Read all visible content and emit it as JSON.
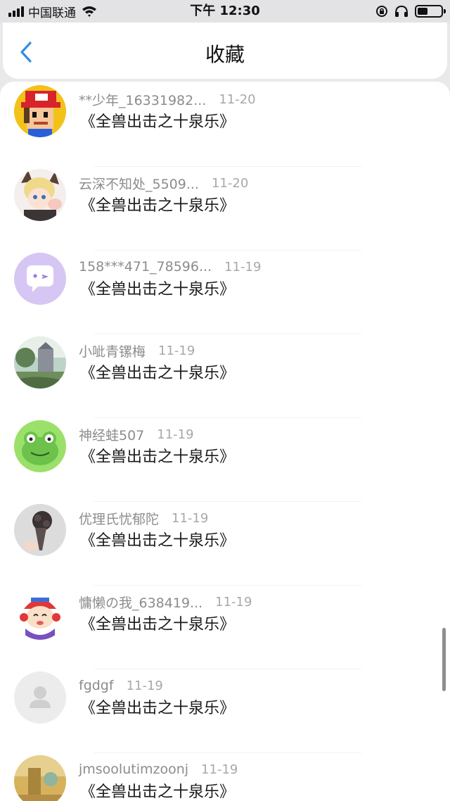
{
  "status_bar": {
    "carrier": "中国联通",
    "time": "下午 12:30",
    "battery_level": 0.45
  },
  "header": {
    "title": "收藏"
  },
  "items": [
    {
      "user": "**少年_16331982...",
      "date": "11-20",
      "content_title": "《全兽出击之十泉乐》",
      "avatar": "pixel-mario-avatar"
    },
    {
      "user": "云深不知处_5509...",
      "date": "11-20",
      "content_title": "《全兽出击之十泉乐》",
      "avatar": "anime-girl-avatar"
    },
    {
      "user": "158***471_78596...",
      "date": "11-19",
      "content_title": "《全兽出击之十泉乐》",
      "avatar": "purple-chat-avatar"
    },
    {
      "user": "小呲青镙梅",
      "date": "11-19",
      "content_title": "《全兽出击之十泉乐》",
      "avatar": "landscape-avatar"
    },
    {
      "user": "神经蛙507",
      "date": "11-19",
      "content_title": "《全兽出击之十泉乐》",
      "avatar": "frog-avatar"
    },
    {
      "user": "优理氏忧郁陀",
      "date": "11-19",
      "content_title": "《全兽出击之十泉乐》",
      "avatar": "flower-bouquet-avatar"
    },
    {
      "user": "慵懒の我_638419...",
      "date": "11-19",
      "content_title": "《全兽出击之十泉乐》",
      "avatar": "cartoon-kid-avatar"
    },
    {
      "user": "fgdgf",
      "date": "11-19",
      "content_title": "《全兽出击之十泉乐》",
      "avatar": "default-user-avatar"
    },
    {
      "user": "jmsoolutimzoonj",
      "date": "11-19",
      "content_title": "《全兽出击之十泉乐》",
      "avatar": "golden-photo-avatar"
    }
  ],
  "colors": {
    "accent": "#2f8fe6",
    "text_primary": "#1a1a1a",
    "text_secondary": "#8c8c8c",
    "background": "#e9e9eb"
  }
}
